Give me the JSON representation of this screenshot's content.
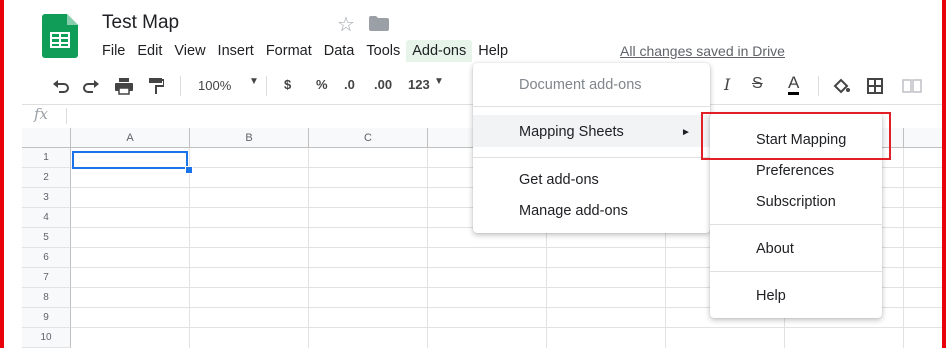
{
  "app": {
    "title": "Test Map",
    "saved_status": "All changes saved in Drive"
  },
  "menubar": [
    "File",
    "Edit",
    "View",
    "Insert",
    "Format",
    "Data",
    "Tools",
    "Add-ons",
    "Help"
  ],
  "toolbar": {
    "zoom": "100%",
    "currency": "$",
    "percent": "%",
    "decrease_decimals": ".0",
    "increase_decimals": ".00",
    "more_formats": "123",
    "italic": "I",
    "strike": "S",
    "text_color": "A"
  },
  "formula_bar": {
    "fx_label": "fx"
  },
  "grid": {
    "columns": [
      "A",
      "B",
      "C"
    ],
    "rows": [
      "1",
      "2",
      "3",
      "4",
      "5",
      "6",
      "7",
      "8",
      "9",
      "10"
    ]
  },
  "addons_menu": {
    "header": "Document add-ons",
    "item_mapping": "Mapping Sheets",
    "arrow": "►",
    "item_get": "Get add-ons",
    "item_manage": "Manage add-ons"
  },
  "mapping_submenu": {
    "start": "Start Mapping",
    "preferences": "Preferences",
    "subscription": "Subscription",
    "about": "About",
    "help": "Help"
  },
  "colors": {
    "accent_green": "#0f9d58",
    "highlight_red": "#e21f26",
    "selection_blue": "#1a73e8"
  }
}
